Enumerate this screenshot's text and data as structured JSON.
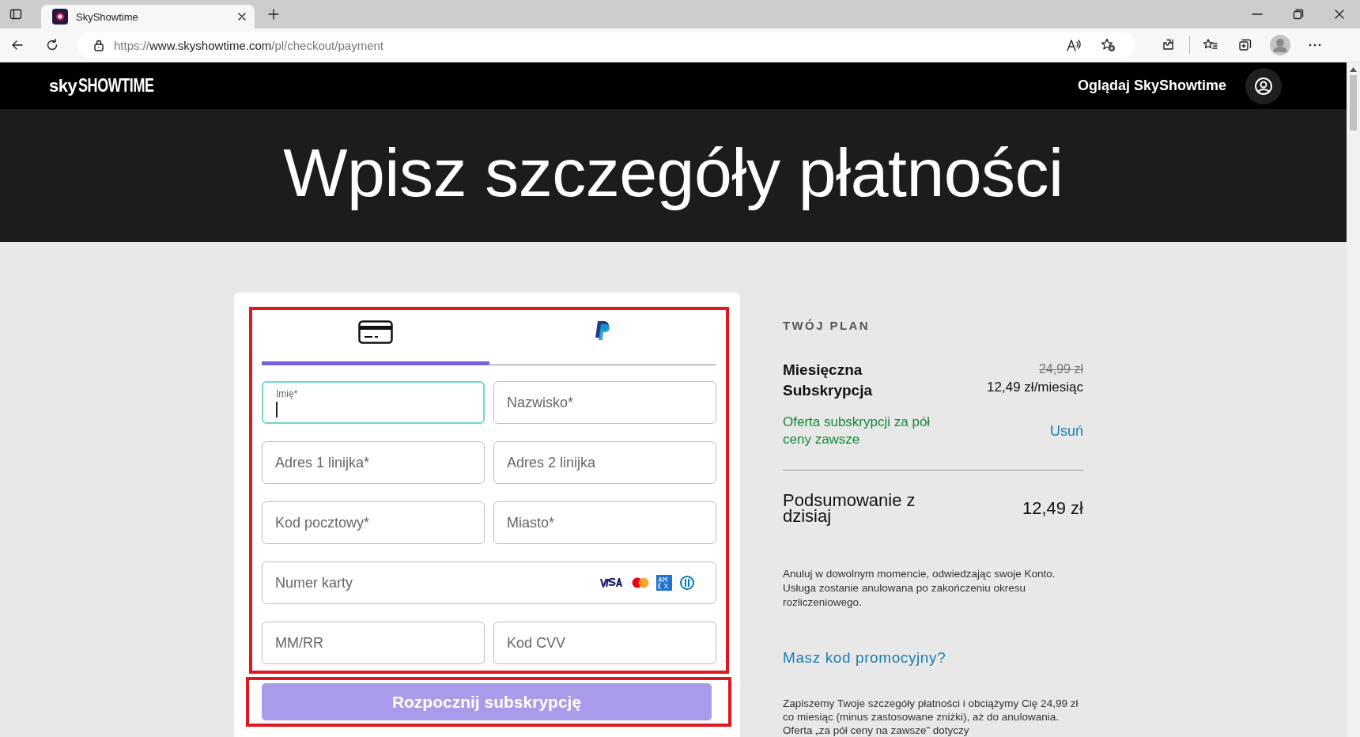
{
  "browser": {
    "tab": {
      "title": "SkyShowtime",
      "selected": true
    },
    "url": {
      "scheme": "https://",
      "host": "www.skyshowtime.com",
      "path": "/pl/checkout/payment"
    }
  },
  "header": {
    "logo": {
      "first": "sky",
      "second": "SHOWTIME"
    },
    "nav_link": "Oglądaj SkyShowtime"
  },
  "hero": {
    "title": "Wpisz szczegóły płatności"
  },
  "payment": {
    "tabs": [
      {
        "kind": "card",
        "selected": true
      },
      {
        "kind": "paypal",
        "selected": false
      }
    ],
    "fields": [
      {
        "kind": "text",
        "label": "Imię*",
        "focused": true
      },
      {
        "kind": "text",
        "label": "Nazwisko*",
        "focused": false
      },
      {
        "kind": "text",
        "label": "Adres 1 linijka*",
        "focused": false
      },
      {
        "kind": "text",
        "label": "Adres 2 linijka",
        "focused": false
      },
      {
        "kind": "text",
        "label": "Kod pocztowy*",
        "focused": false
      },
      {
        "kind": "text",
        "label": "Miasto*",
        "focused": false
      },
      {
        "kind": "card_number",
        "label": "Numer karty",
        "focused": false
      },
      {
        "kind": "text",
        "label": "MM/RR",
        "focused": false
      },
      {
        "kind": "text",
        "label": "Kod CVV",
        "focused": false
      }
    ],
    "submit": {
      "label": "Rozpocznij subskrypcję",
      "disabled": true
    }
  },
  "plan": {
    "heading": "TWÓJ PLAN",
    "name": "Miesięczna Subskrypcja",
    "old_price": "24,99 zł",
    "price": "12,49 zł/miesiąc",
    "offer": "Oferta subskrypcji za pół ceny zawsze",
    "remove": "Usuń",
    "total_label": "Podsumowanie z dzisiaj",
    "total": "12,49 zł",
    "cancel_note": "Anuluj w dowolnym momencie, odwiedzając swoje Konto. Usługa zostanie anulowana po zakończeniu okresu rozliczeniowego.",
    "promo_link": "Masz kod promocyjny?",
    "billing_note": "Zapiszemy Twoje szczegóły płatności i obciążymy Cię 24,99 zł co miesiąc (minus zastosowane zniżki), aż do anulowania. Oferta „za pół ceny na zawsze” dotyczy"
  }
}
